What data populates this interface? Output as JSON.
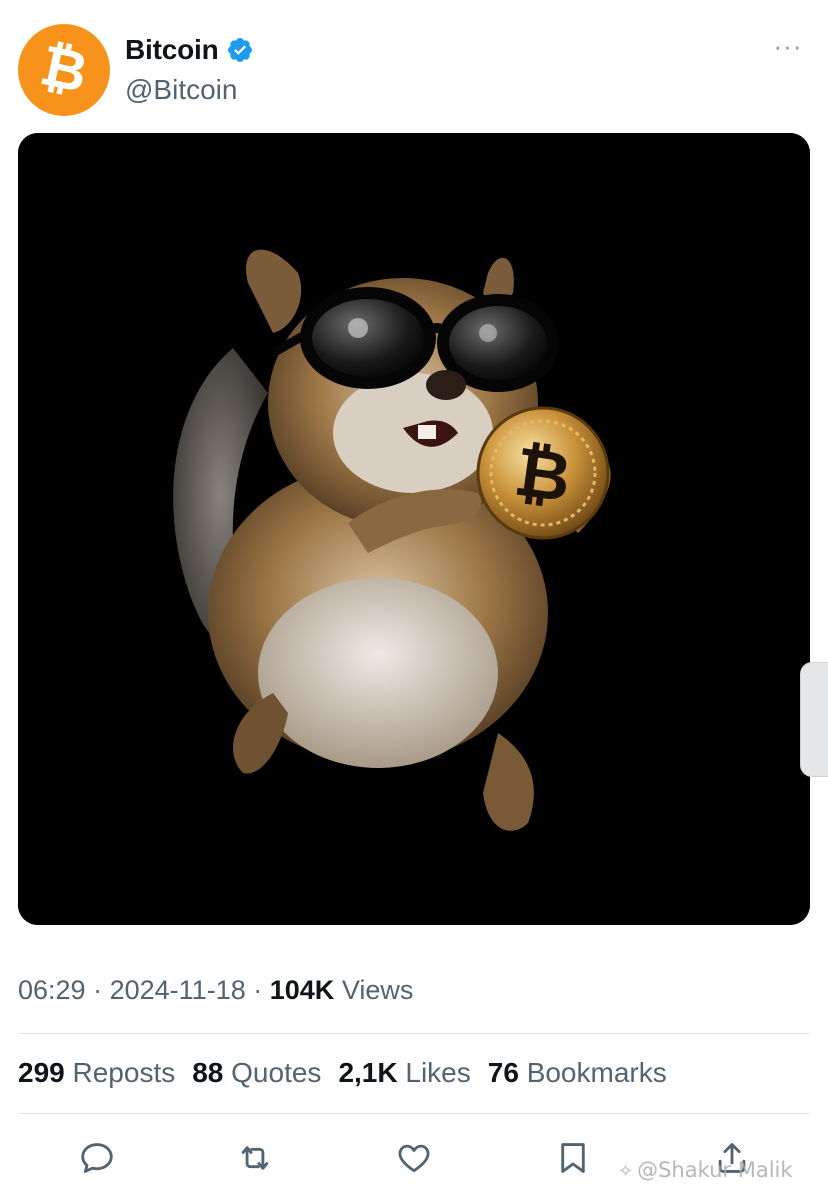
{
  "account": {
    "display_name": "Bitcoin",
    "handle": "@Bitcoin",
    "avatar_symbol": "₿",
    "verified": true,
    "brand_color": "#f7931a",
    "verified_color": "#1d9bf0"
  },
  "header": {
    "more_label": "···"
  },
  "media": {
    "coin_symbol": "₿"
  },
  "meta": {
    "time": "06:29",
    "separator": "·",
    "date": "2024-11-18",
    "views_count": "104K",
    "views_label": "Views"
  },
  "stats": [
    {
      "count": "299",
      "label": "Reposts"
    },
    {
      "count": "88",
      "label": "Quotes"
    },
    {
      "count": "2,1K",
      "label": "Likes"
    },
    {
      "count": "76",
      "label": "Bookmarks"
    }
  ],
  "actions": [
    {
      "icon": "reply-icon"
    },
    {
      "icon": "repost-icon"
    },
    {
      "icon": "like-icon"
    },
    {
      "icon": "bookmark-icon"
    },
    {
      "icon": "share-icon"
    }
  ],
  "watermark": {
    "text": "@Shakur Malik"
  }
}
